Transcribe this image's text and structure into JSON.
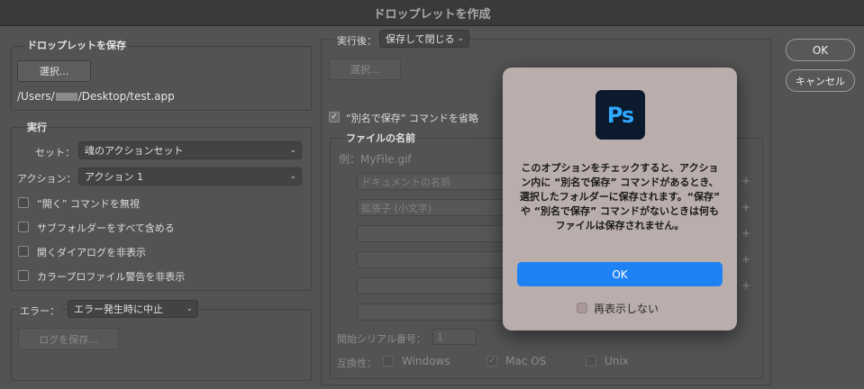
{
  "window": {
    "title": "ドロップレットを作成"
  },
  "save_group": {
    "title": "ドロップレットを保存",
    "choose_label": "選択...",
    "path_prefix": "/Users/",
    "path_suffix": "/Desktop/test.app"
  },
  "run_group": {
    "title": "実行",
    "set_label": "セット：",
    "set_value": "魂のアクションセット",
    "action_label": "アクション：",
    "action_value": "アクション 1",
    "checkboxes": [
      {
        "label": "“開く” コマンドを無視",
        "checked": false
      },
      {
        "label": "サブフォルダーをすべて含める",
        "checked": false
      },
      {
        "label": "開くダイアログを非表示",
        "checked": false
      },
      {
        "label": "カラープロファイル警告を非表示",
        "checked": false
      }
    ]
  },
  "error_group": {
    "label": "エラー：",
    "value": "エラー発生時に中止",
    "save_log_label": "ログを保存..."
  },
  "after_run": {
    "label": "実行後：",
    "value": "保存して閉じる",
    "choose_label": "選択...",
    "override_label": "“別名で保存” コマンドを省略",
    "override_checked": true
  },
  "file_naming": {
    "title": "ファイルの名前",
    "example": "例：MyFile.gif",
    "fields": [
      "ドキュメントの名前",
      "拡張子 (小文字)",
      "",
      "",
      "",
      ""
    ],
    "plus_symbol": "+",
    "serial_label": "開始シリアル番号：",
    "serial_value": "1",
    "compat_label": "互換性：",
    "compat": [
      {
        "label": "Windows",
        "checked": false
      },
      {
        "label": "Mac OS",
        "checked": true
      },
      {
        "label": "Unix",
        "checked": false
      }
    ]
  },
  "buttons": {
    "ok": "OK",
    "cancel": "キャンセル"
  },
  "alert": {
    "icon_text": "Ps",
    "message": "このオプションをチェックすると、アクション内に “別名で保存” コマンドがあるとき、選択したフォルダーに保存されます。“保存” や “別名で保存” コマンドがないときは何もファイルは保存されません。",
    "ok_label": "OK",
    "dont_show_label": "再表示しない"
  },
  "colors": {
    "accent": "#1f82f4",
    "ps_blue": "#2fa8ff",
    "ps_bg": "#0b1a2c"
  }
}
